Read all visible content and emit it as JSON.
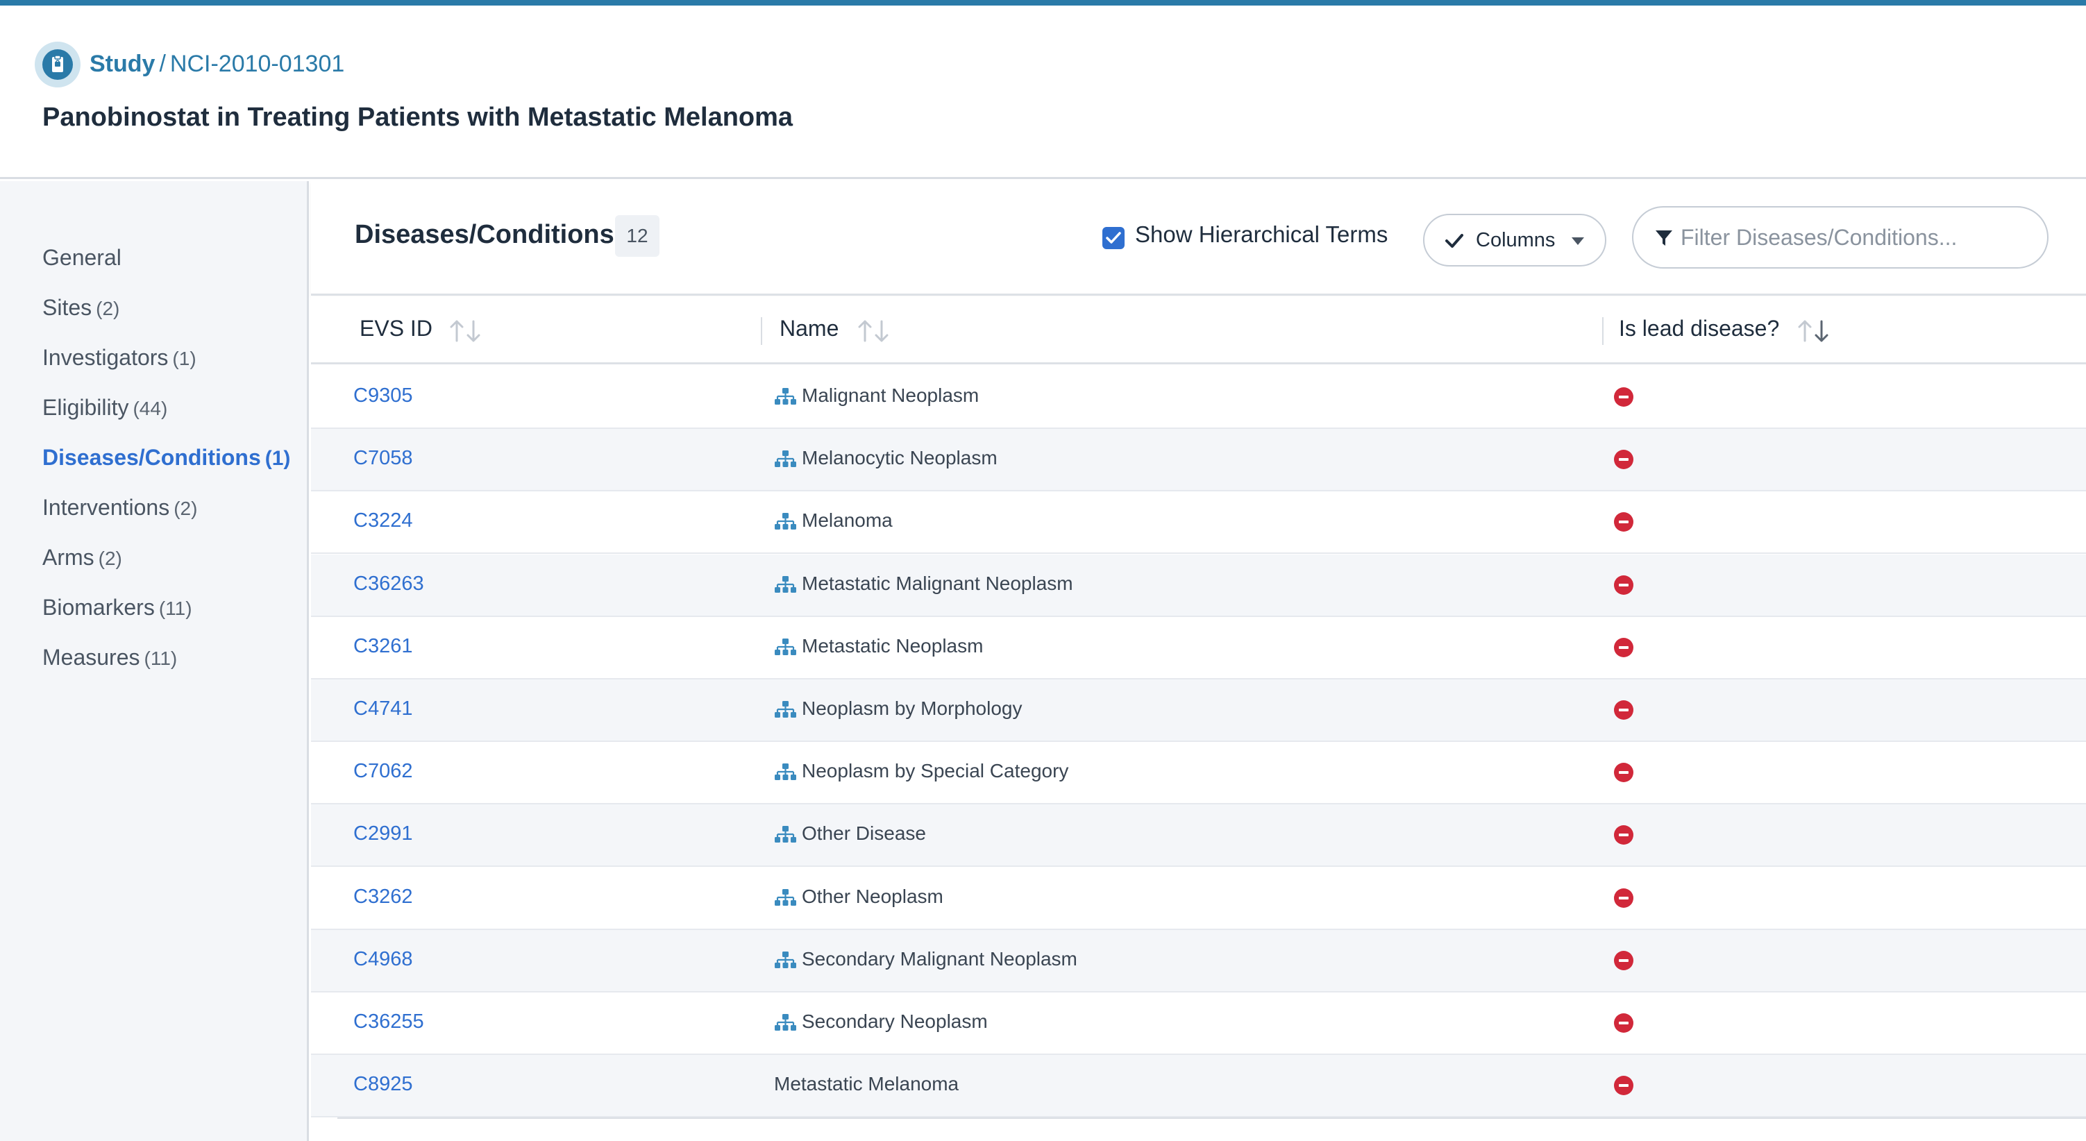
{
  "colors": {
    "accent": "#2a7aa8",
    "link": "#2f6fd0",
    "danger": "#d1283a",
    "sidebar_bg": "#f4f6f9"
  },
  "header": {
    "icon": "clipboard-icon",
    "breadcrumb_root": "Study",
    "breadcrumb_sep": "/",
    "breadcrumb_id": "NCI-2010-01301",
    "title": "Panobinostat in Treating Patients with Metastatic Melanoma"
  },
  "sidebar": {
    "items": [
      {
        "label": "General",
        "count": ""
      },
      {
        "label": "Sites",
        "count": "(2)"
      },
      {
        "label": "Investigators",
        "count": "(1)"
      },
      {
        "label": "Eligibility",
        "count": "(44)"
      },
      {
        "label": "Diseases/Conditions",
        "count": "(1)",
        "active": true
      },
      {
        "label": "Interventions",
        "count": "(2)"
      },
      {
        "label": "Arms",
        "count": "(2)"
      },
      {
        "label": "Biomarkers",
        "count": "(11)"
      },
      {
        "label": "Measures",
        "count": "(11)"
      }
    ]
  },
  "panel": {
    "title": "Diseases/Conditions",
    "count": "12",
    "show_hierarchical_label": "Show Hierarchical Terms",
    "show_hierarchical_checked": true,
    "columns_label": "Columns",
    "filter_placeholder": "Filter Diseases/Conditions..."
  },
  "table": {
    "columns": [
      "EVS ID",
      "Name",
      "Is lead disease?"
    ],
    "rows": [
      {
        "id": "C9305",
        "name": "Malignant Neoplasm",
        "hierarchical": true,
        "lead": "no"
      },
      {
        "id": "C7058",
        "name": "Melanocytic Neoplasm",
        "hierarchical": true,
        "lead": "no"
      },
      {
        "id": "C3224",
        "name": "Melanoma",
        "hierarchical": true,
        "lead": "no"
      },
      {
        "id": "C36263",
        "name": "Metastatic Malignant Neoplasm",
        "hierarchical": true,
        "lead": "no"
      },
      {
        "id": "C3261",
        "name": "Metastatic Neoplasm",
        "hierarchical": true,
        "lead": "no"
      },
      {
        "id": "C4741",
        "name": "Neoplasm by Morphology",
        "hierarchical": true,
        "lead": "no"
      },
      {
        "id": "C7062",
        "name": "Neoplasm by Special Category",
        "hierarchical": true,
        "lead": "no"
      },
      {
        "id": "C2991",
        "name": "Other Disease",
        "hierarchical": true,
        "lead": "no"
      },
      {
        "id": "C3262",
        "name": "Other Neoplasm",
        "hierarchical": true,
        "lead": "no"
      },
      {
        "id": "C4968",
        "name": "Secondary Malignant Neoplasm",
        "hierarchical": true,
        "lead": "no"
      },
      {
        "id": "C36255",
        "name": "Secondary Neoplasm",
        "hierarchical": true,
        "lead": "no"
      },
      {
        "id": "C8925",
        "name": "Metastatic Melanoma",
        "hierarchical": false,
        "lead": "no"
      }
    ]
  }
}
